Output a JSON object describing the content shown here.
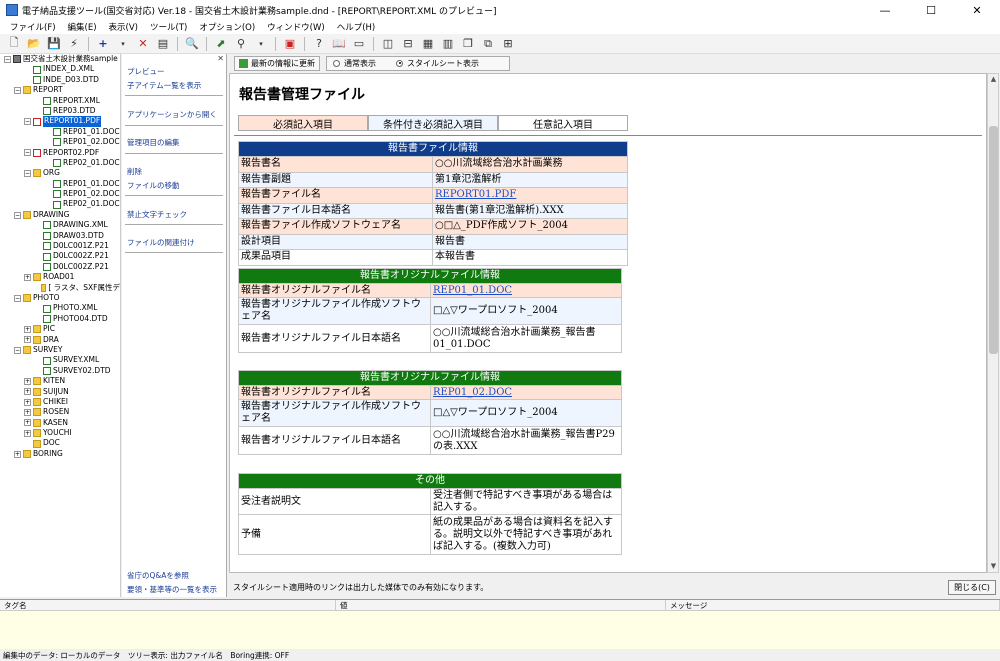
{
  "window": {
    "title": "電子納品支援ツール(国交省対応) Ver.18 - 国交省土木設計業務sample.dnd - [REPORT\\REPORT.XML のプレビュー]",
    "minimize": "—",
    "maximize": "☐",
    "close": "✕"
  },
  "menu": [
    "ファイル(F)",
    "編集(E)",
    "表示(V)",
    "ツール(T)",
    "オプション(O)",
    "ウィンドウ(W)",
    "ヘルプ(H)"
  ],
  "tree": {
    "items": [
      {
        "label": "国交省土木設計業務sample",
        "indent": 0,
        "type": "root",
        "exp": "−"
      },
      {
        "label": "INDEX_D.XML",
        "indent": 2,
        "type": "file",
        "exp": ""
      },
      {
        "label": "INDE_D03.DTD",
        "indent": 2,
        "type": "file",
        "exp": ""
      },
      {
        "label": "REPORT",
        "indent": 1,
        "type": "folder",
        "exp": "−"
      },
      {
        "label": "REPORT.XML",
        "indent": 3,
        "type": "file",
        "exp": ""
      },
      {
        "label": "REP03.DTD",
        "indent": 3,
        "type": "file",
        "exp": ""
      },
      {
        "label": "REPORT01.PDF",
        "indent": 2,
        "type": "pdf",
        "exp": "−",
        "selected": true
      },
      {
        "label": "REP01_01.DOC",
        "indent": 4,
        "type": "file",
        "exp": ""
      },
      {
        "label": "REP01_02.DOC",
        "indent": 4,
        "type": "file",
        "exp": ""
      },
      {
        "label": "REPORT02.PDF",
        "indent": 2,
        "type": "pdf",
        "exp": "−"
      },
      {
        "label": "REP02_01.DOC",
        "indent": 4,
        "type": "file",
        "exp": ""
      },
      {
        "label": "ORG",
        "indent": 2,
        "type": "folder",
        "exp": "−"
      },
      {
        "label": "REP01_01.DOC",
        "indent": 4,
        "type": "file",
        "exp": ""
      },
      {
        "label": "REP01_02.DOC",
        "indent": 4,
        "type": "file",
        "exp": ""
      },
      {
        "label": "REP02_01.DOC",
        "indent": 4,
        "type": "file",
        "exp": ""
      },
      {
        "label": "DRAWING",
        "indent": 1,
        "type": "folder",
        "exp": "−"
      },
      {
        "label": "DRAWING.XML",
        "indent": 3,
        "type": "file",
        "exp": ""
      },
      {
        "label": "DRAW03.DTD",
        "indent": 3,
        "type": "file",
        "exp": ""
      },
      {
        "label": "D0LC001Z.P21",
        "indent": 3,
        "type": "file",
        "exp": ""
      },
      {
        "label": "D0LC002Z.P21",
        "indent": 3,
        "type": "file",
        "exp": ""
      },
      {
        "label": "D0LC002Z.P21",
        "indent": 3,
        "type": "file",
        "exp": ""
      },
      {
        "label": "ROAD01",
        "indent": 2,
        "type": "folder",
        "exp": "+"
      },
      {
        "label": "[ ラスタ、SXF属性デ",
        "indent": 3,
        "type": "folder",
        "exp": ""
      },
      {
        "label": "PHOTO",
        "indent": 1,
        "type": "folder",
        "exp": "−"
      },
      {
        "label": "PHOTO.XML",
        "indent": 3,
        "type": "file",
        "exp": ""
      },
      {
        "label": "PHOTO04.DTD",
        "indent": 3,
        "type": "file",
        "exp": ""
      },
      {
        "label": "PIC",
        "indent": 2,
        "type": "folder",
        "exp": "+"
      },
      {
        "label": "DRA",
        "indent": 2,
        "type": "folder",
        "exp": "+"
      },
      {
        "label": "SURVEY",
        "indent": 1,
        "type": "folder",
        "exp": "−"
      },
      {
        "label": "SURVEY.XML",
        "indent": 3,
        "type": "file",
        "exp": ""
      },
      {
        "label": "SURVEY02.DTD",
        "indent": 3,
        "type": "file",
        "exp": ""
      },
      {
        "label": "KITEN",
        "indent": 2,
        "type": "folder",
        "exp": "+"
      },
      {
        "label": "SUIJUN",
        "indent": 2,
        "type": "folder",
        "exp": "+"
      },
      {
        "label": "CHIKEI",
        "indent": 2,
        "type": "folder",
        "exp": "+"
      },
      {
        "label": "ROSEN",
        "indent": 2,
        "type": "folder",
        "exp": "+"
      },
      {
        "label": "KASEN",
        "indent": 2,
        "type": "folder",
        "exp": "+"
      },
      {
        "label": "YOUCHI",
        "indent": 2,
        "type": "folder",
        "exp": "+"
      },
      {
        "label": "DOC",
        "indent": 2,
        "type": "folder",
        "exp": ""
      },
      {
        "label": "BORING",
        "indent": 1,
        "type": "folder",
        "exp": "+"
      }
    ]
  },
  "actions": {
    "preview": "プレビュー",
    "child_list": "子アイテム一覧を表示",
    "open_app": "アプリケーションから開く",
    "edit_items": "管理項目の編集",
    "delete": "削除",
    "move_file": "ファイルの移動",
    "forbidden_check": "禁止文字チェック",
    "relate_file": "ファイルの関連付け",
    "qa": "省庁のQ&Aを参照",
    "standards": "要領・基準等の一覧を表示"
  },
  "viewbar": {
    "refresh": "最新の情報に更新",
    "normal": "通常表示",
    "stylesheet": "スタイルシート表示"
  },
  "doc": {
    "title": "報告書管理ファイル",
    "legend": [
      "必須記入項目",
      "条件付き必須記入項目",
      "任意記入項目"
    ],
    "report_info": {
      "header": "報告書ファイル情報",
      "rows": [
        {
          "k": "報告書名",
          "v": "○○川流域総合治水計画業務",
          "kind": "req"
        },
        {
          "k": "報告書副題",
          "v": "第1章氾濫解析",
          "kind": "cond"
        },
        {
          "k": "報告書ファイル名",
          "v": "REPORT01.PDF",
          "kind": "req",
          "link": true
        },
        {
          "k": "報告書ファイル日本語名",
          "v": "報告書(第1章氾濫解析).XXX",
          "kind": "cond"
        },
        {
          "k": "報告書ファイル作成ソフトウェア名",
          "v": "○□△_PDF作成ソフト_2004",
          "kind": "req"
        },
        {
          "k": "設計項目",
          "v": "報告書",
          "kind": "cond"
        },
        {
          "k": "成果品項目",
          "v": "本報告書",
          "kind": "plain"
        }
      ]
    },
    "orig1": {
      "header": "報告書オリジナルファイル情報",
      "name_k": "報告書オリジナルファイル名",
      "name_v": "REP01_01.DOC",
      "soft_k": "報告書オリジナルファイル作成ソフトウェア名",
      "soft_v": "□△▽ワープロソフト_2004",
      "jp_k": "報告書オリジナルファイル日本語名",
      "jp_v": "○○川流域総合治水計画業務_報告書01_01.DOC"
    },
    "orig2": {
      "header": "報告書オリジナルファイル情報",
      "name_k": "報告書オリジナルファイル名",
      "name_v": "REP01_02.DOC",
      "soft_k": "報告書オリジナルファイル作成ソフトウェア名",
      "soft_v": "□△▽ワープロソフト_2004",
      "jp_k": "報告書オリジナルファイル日本語名",
      "jp_v": "○○川流域総合治水計画業務_報告書P29の表.XXX"
    },
    "other": {
      "header": "その他",
      "c_k": "受注者説明文",
      "c_v": "受注者側で特記すべき事項がある場合は記入する。",
      "r_k": "予備",
      "r_v": "紙の成果品がある場合は資料名を記入する。説明文以外で特記すべき事項があれば記入する。(複数入力可)"
    }
  },
  "status": {
    "note": "スタイルシート適用時のリンクは出力した媒体でのみ有効になります。",
    "close": "閉じる(C)"
  },
  "msg": {
    "col_tag": "タグ名",
    "col_value": "値",
    "col_message": "メッセージ"
  },
  "bottom": "編集中のデータ: ローカルのデータ　ツリー表示: 出力ファイル名　Boring連携: OFF",
  "colors": {
    "blue_header": "#0f3d8c",
    "green_header": "#107a10",
    "required_bg": "#ffe3d6",
    "conditional_bg": "#eef5fe",
    "link": "#1a50c8"
  }
}
